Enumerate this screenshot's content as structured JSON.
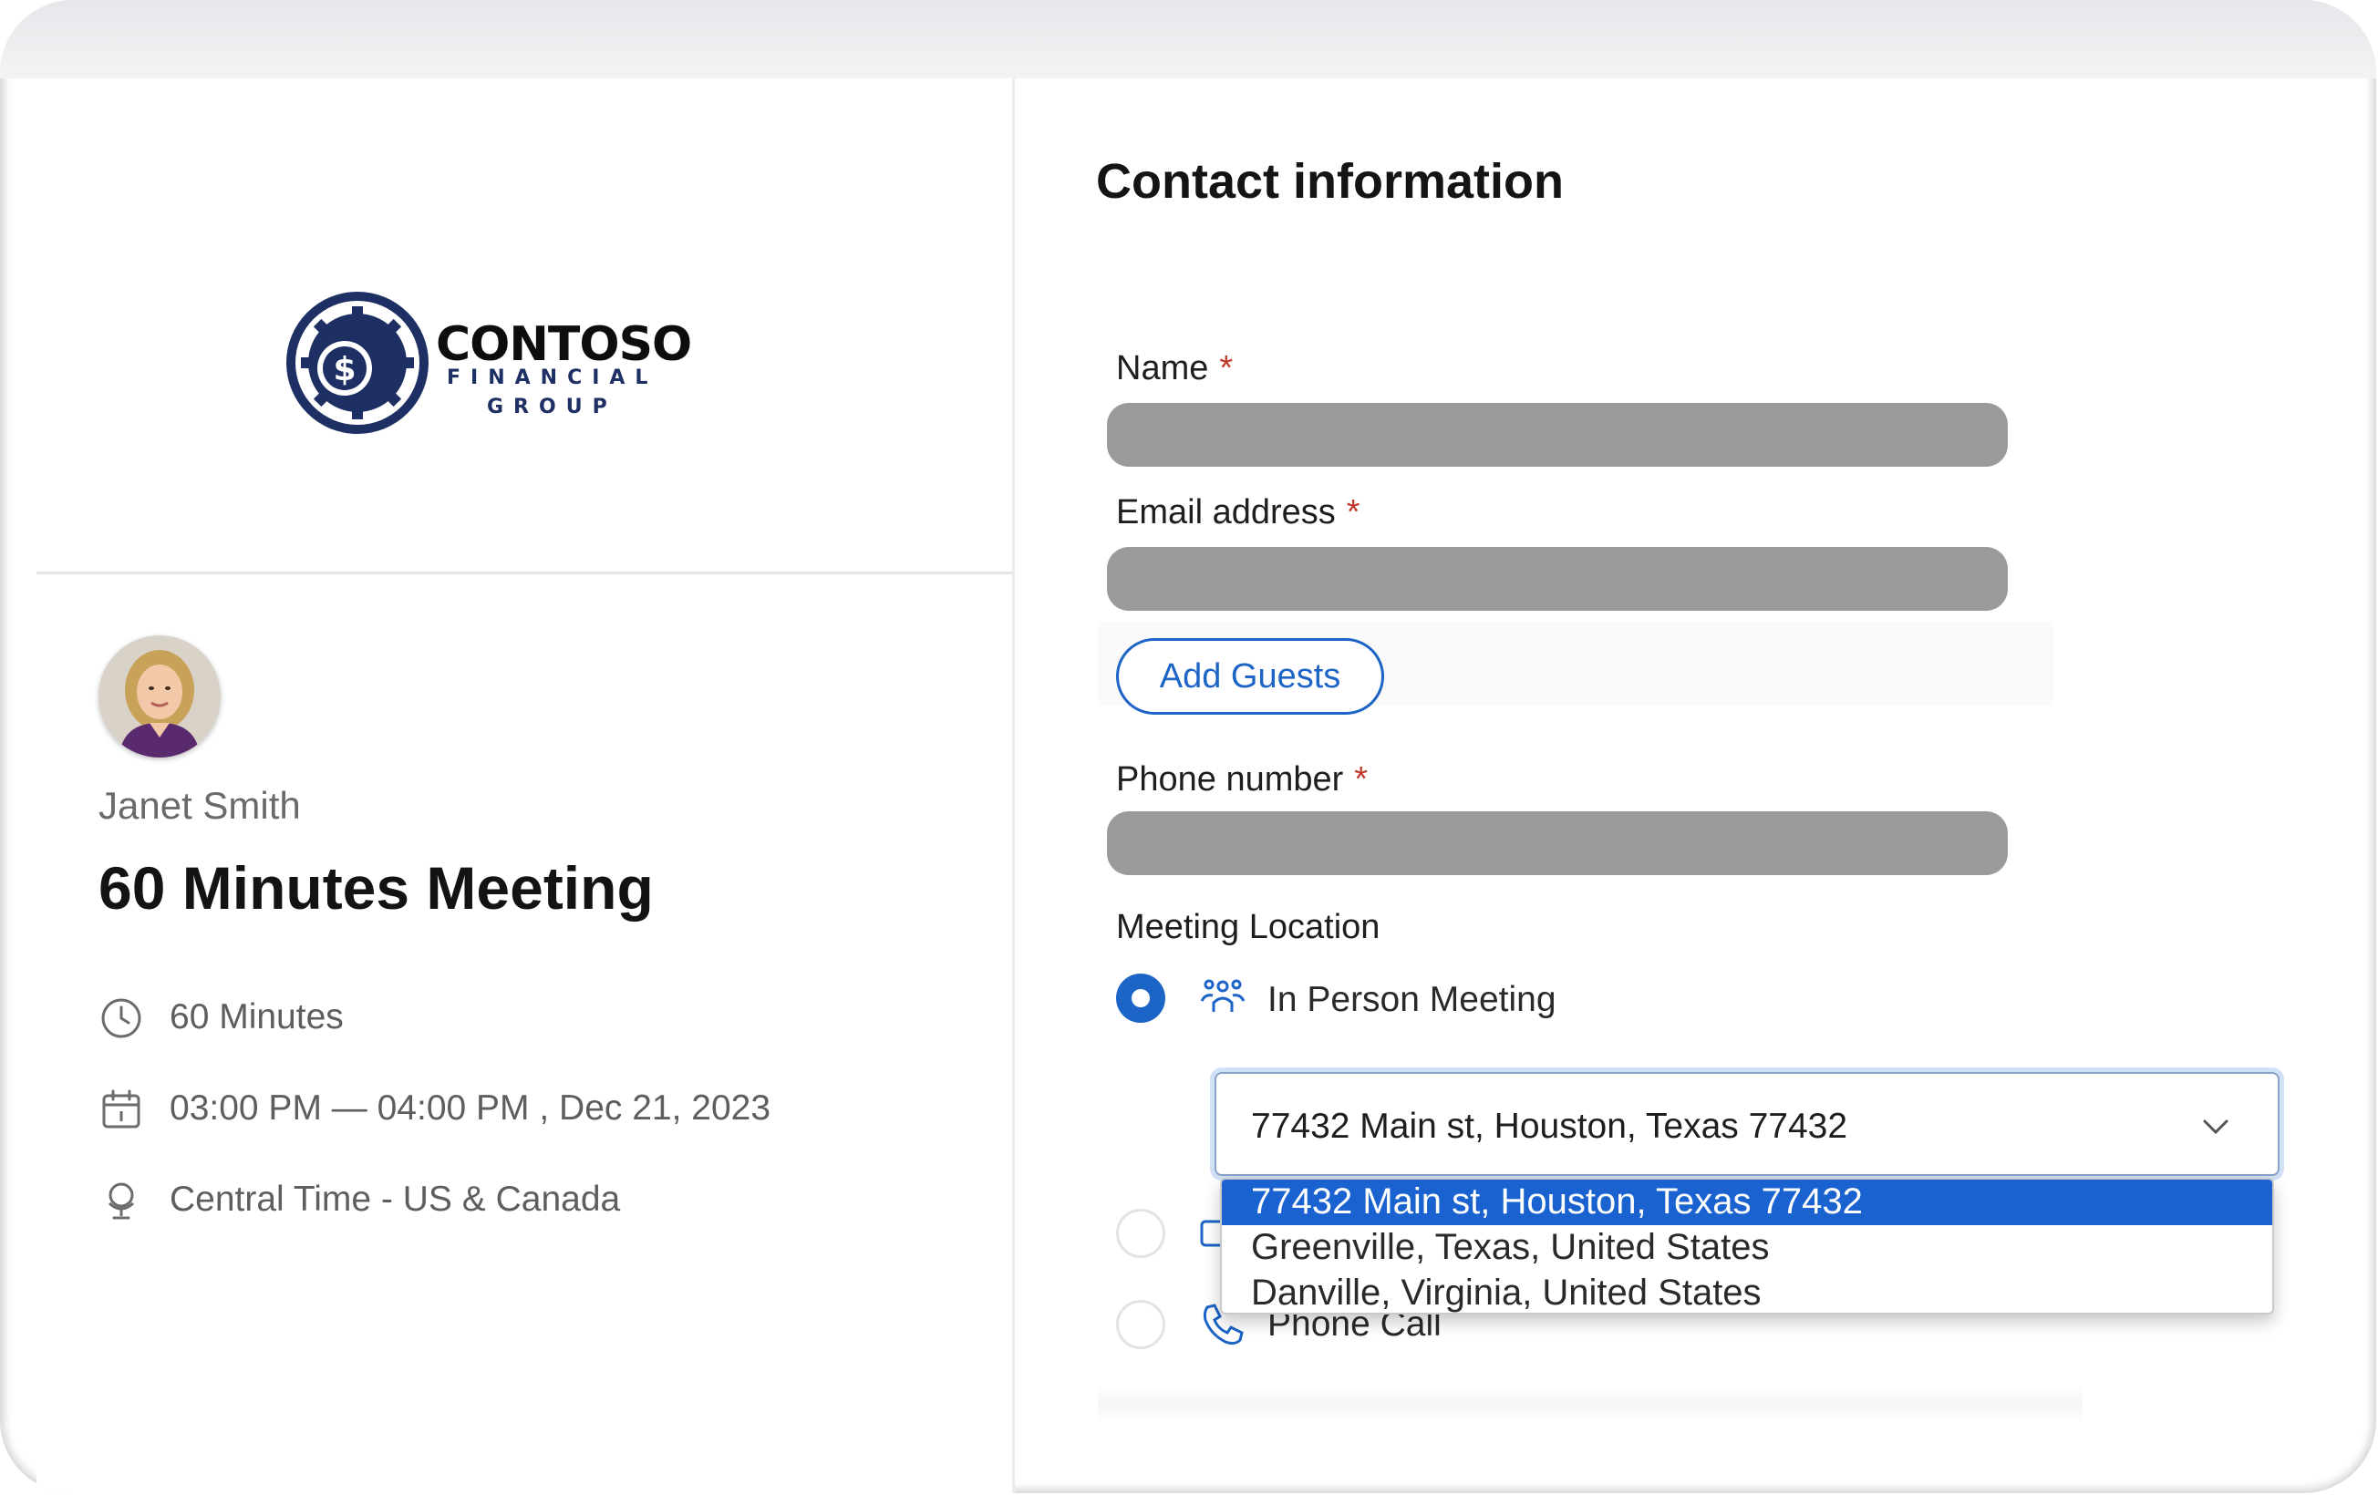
{
  "brand": {
    "line1": "CONTOSO",
    "line2": "FINANCIAL",
    "line3": "GROUP",
    "colors": {
      "navy": "#1e2f63",
      "accent": "#1c65c6"
    }
  },
  "host": {
    "name": "Janet Smith"
  },
  "meeting": {
    "title": "60 Minutes Meeting",
    "duration": "60 Minutes",
    "time": "03:00 PM — 04:00 PM , Dec 21, 2023",
    "timezone": "Central Time - US & Canada"
  },
  "form": {
    "title": "Contact information",
    "name_label": "Name",
    "email_label": "Email address",
    "phone_label": "Phone number",
    "required_marker": "*",
    "add_guests_label": "Add Guests",
    "location_label": "Meeting Location",
    "location_options": [
      {
        "label": "In Person Meeting",
        "icon": "people-group-icon",
        "selected": true
      },
      {
        "label": "",
        "icon": "video-icon",
        "selected": false
      },
      {
        "label": "Phone Call",
        "icon": "phone-icon",
        "selected": false
      }
    ],
    "address_select": {
      "value": "77432 Main st, Houston, Texas 77432",
      "options": [
        "77432 Main st, Houston, Texas 77432",
        "Greenville, Texas, United States",
        "Danville, Virginia, United States"
      ],
      "selected_index": 0
    }
  }
}
